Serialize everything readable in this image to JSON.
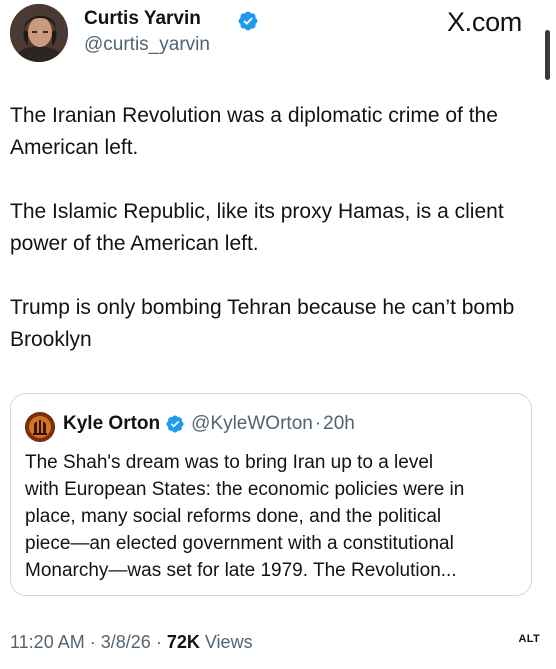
{
  "author": {
    "name": "Curtis Yarvin",
    "handle": "@curtis_yarvin",
    "verified": true
  },
  "site_mark": "X.com",
  "tweet": {
    "paragraphs": [
      "The Iranian Revolution was a diplomatic crime of the American left.",
      "The Islamic Republic, like its proxy Hamas, is a client power of the American left.",
      "Trump is only bombing Tehran because he can’t bomb Brooklyn"
    ]
  },
  "quoted": {
    "name": "Kyle Orton",
    "handle": "@KyleWOrton",
    "separator": "·",
    "time": "20h",
    "verified": true,
    "lines": [
      "The Shah's dream was to bring Iran up to a level",
      "with European States: the economic policies were in",
      "place, many social reforms done, and the political",
      "piece—an elected government with a constitutional",
      "Monarchy—was set for late 1979. The Revolution..."
    ]
  },
  "meta": {
    "time": "11:20 AM",
    "sep1": "·",
    "date": "3/8/26",
    "sep2": "·",
    "views_count": "72K",
    "views_label": "Views"
  },
  "alt_badge": "ALT",
  "colors": {
    "verified_badge": "#1d9bf0",
    "secondary_text": "#536471",
    "primary_text": "#0f1419",
    "border": "#cfd9de"
  }
}
